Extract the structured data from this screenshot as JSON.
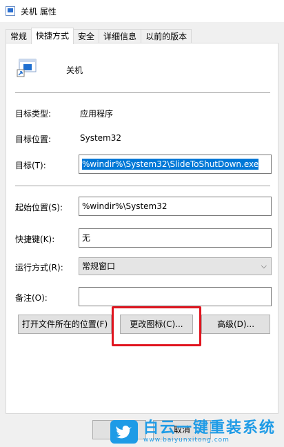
{
  "window": {
    "title": "关机 属性"
  },
  "tabs": [
    {
      "label": "常规"
    },
    {
      "label": "快捷方式",
      "active": true
    },
    {
      "label": "安全"
    },
    {
      "label": "详细信息"
    },
    {
      "label": "以前的版本"
    }
  ],
  "shortcut": {
    "name": "关机",
    "target_type_label": "目标类型:",
    "target_type_value": "应用程序",
    "target_location_label": "目标位置:",
    "target_location_value": "System32",
    "target_label": "目标(T):",
    "target_value": "%windir%\\System32\\SlideToShutDown.exe",
    "start_in_label": "起始位置(S):",
    "start_in_value": "%windir%\\System32",
    "hotkey_label": "快捷键(K):",
    "hotkey_value": "无",
    "run_label": "运行方式(R):",
    "run_value": "常规窗口",
    "comment_label": "备注(O):",
    "comment_value": ""
  },
  "buttons": {
    "open_location": "打开文件所在的位置(F)",
    "change_icon": "更改图标(C)...",
    "advanced": "高级(D)...",
    "cancel": "取消"
  },
  "watermark": {
    "main": "白云一键重装系统",
    "sub": "www.baiyunxitong.com"
  },
  "colors": {
    "selection": "#0078d7",
    "highlight_box": "#e0141e",
    "watermark": "#1e9be6"
  }
}
